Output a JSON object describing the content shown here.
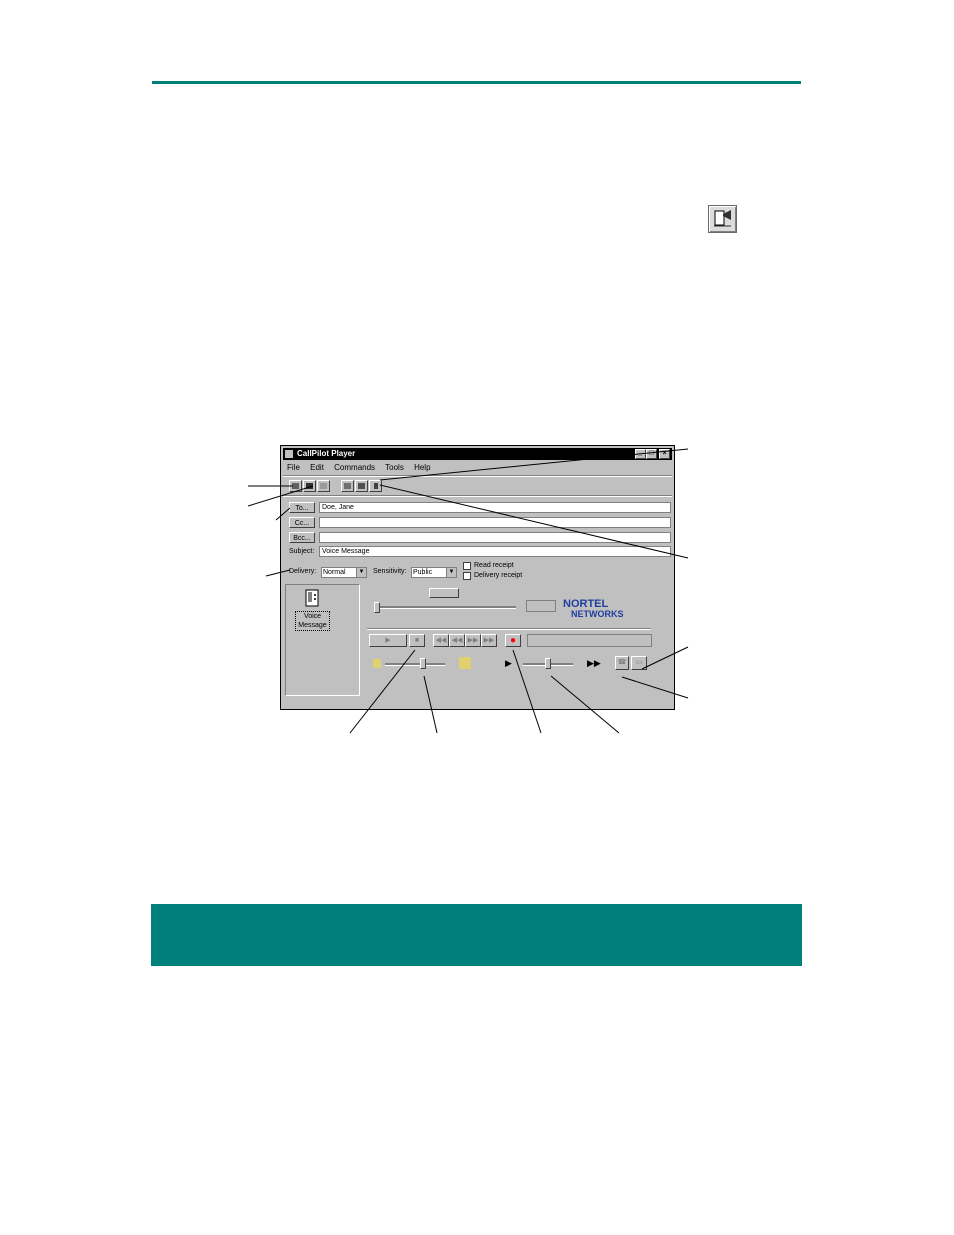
{
  "colors": {
    "accent": "#00807a",
    "brand_blue": "#1f3f9f",
    "record_red": "#ff0000"
  },
  "window": {
    "title": "CallPilot Player",
    "menu": [
      "File",
      "Edit",
      "Commands",
      "Tools",
      "Help"
    ],
    "toolbar_icons": [
      "send-icon",
      "save-icon",
      "print-icon",
      "address-book-icon",
      "new-message-icon",
      "attach-icon"
    ],
    "header": {
      "to_label": "To...",
      "to_value": "Doe, Jane",
      "cc_label": "Cc...",
      "cc_value": "",
      "bcc_label": "Bcc...",
      "bcc_value": "",
      "subject_label": "Subject:",
      "subject_value": "Voice Message"
    },
    "options": {
      "delivery_label": "Delivery:",
      "delivery_value": "Normal",
      "sensitivity_label": "Sensitivity:",
      "sensitivity_value": "Public",
      "read_receipt_label": "Read receipt",
      "delivery_receipt_label": "Delivery receipt"
    },
    "attachment_label_line1": "Voice",
    "attachment_label_line2": "Message",
    "brand_line1": "NORTEL",
    "brand_line2": "NETWORKS"
  }
}
